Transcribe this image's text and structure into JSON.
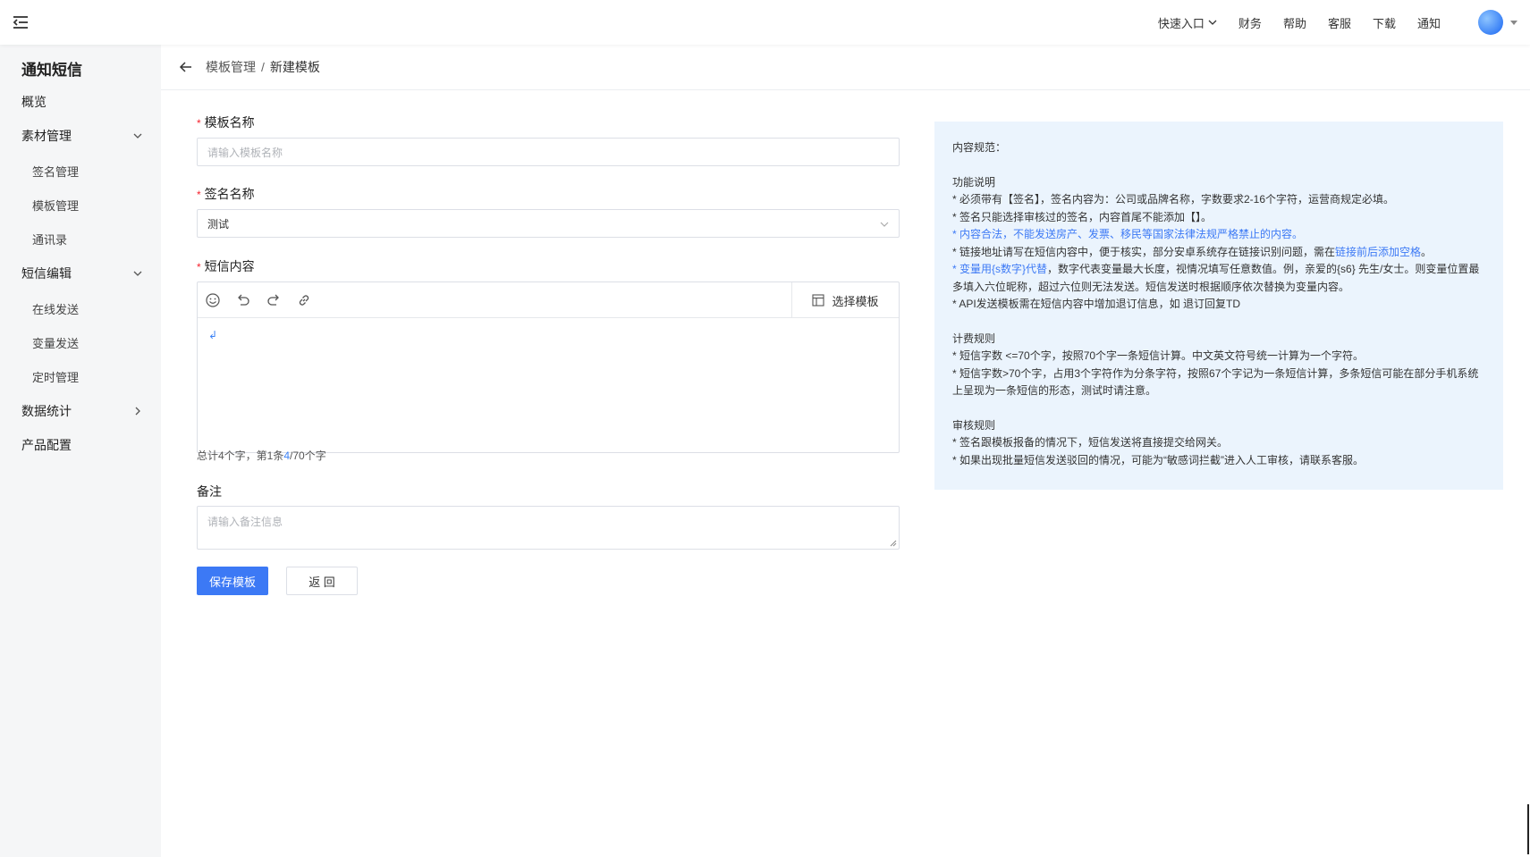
{
  "topbar": {
    "quick_entry": "快速入口",
    "nav": [
      "财务",
      "帮助",
      "客服",
      "下载",
      "通知"
    ]
  },
  "sidebar": {
    "title": "通知短信",
    "overview": "概览",
    "material": "素材管理",
    "material_items": [
      "签名管理",
      "模板管理",
      "通讯录"
    ],
    "sms_edit": "短信编辑",
    "sms_items": [
      "在线发送",
      "变量发送",
      "定时管理"
    ],
    "stats": "数据统计",
    "product_config": "产品配置"
  },
  "breadcrumb": {
    "parent": "模板管理",
    "separator": "/",
    "current": "新建模板"
  },
  "form": {
    "template_name_label": "模板名称",
    "template_name_placeholder": "请输入模板名称",
    "signature_label": "签名名称",
    "signature_value": "测试",
    "content_label": "短信内容",
    "select_template": "选择模板",
    "editor_content": "↲",
    "count_prefix": "总计4个字，第1条",
    "count_current": "4",
    "count_suffix": "/70个字",
    "remark_label": "备注",
    "remark_placeholder": "请输入备注信息",
    "save_button": "保存模板",
    "back_button": "返 回"
  },
  "rules": {
    "title": "内容规范：",
    "func_title": "功能说明",
    "func_1": "* 必须带有【签名】，签名内容为：公司或品牌名称，字数要求2-16个字符，运营商规定必填。",
    "func_2": "* 签名只能选择审核过的签名，内容首尾不能添加【】。",
    "func_3": "* 内容合法，不能发送房产、发票、移民等国家法律法规严格禁止的内容。",
    "func_4a": "* 链接地址请写在短信内容中，便于核实，部分安卓系统存在链接识别问题，需在",
    "func_4b": "链接前后添加空格",
    "func_4c": "。",
    "func_5a": "* 变量用{s数字}代替",
    "func_5b": "，数字代表变量最大长度，视情况填写任意数值。例，亲爱的{s6} 先生/女士。则变量位置最多填入六位昵称，超过六位则无法发送。短信发送时根据顺序依次替换为变量内容。",
    "func_6": "* API发送模板需在短信内容中增加退订信息，如 退订回复TD",
    "billing_title": "计费规则",
    "billing_1": "* 短信字数 <=70个字，按照70个字一条短信计算。中文英文符号统一计算为一个字符。",
    "billing_2": "* 短信字数>70个字，占用3个字符作为分条字符，按照67个字记为一条短信计算，多条短信可能在部分手机系统上呈现为一条短信的形态，测试时请注意。",
    "audit_title": "审核规则",
    "audit_1": "* 签名跟模板报备的情况下，短信发送将直接提交给网关。",
    "audit_2": "* 如果出现批量短信发送驳回的情况，可能为“敏感词拦截”进入人工审核，请联系客服。"
  }
}
